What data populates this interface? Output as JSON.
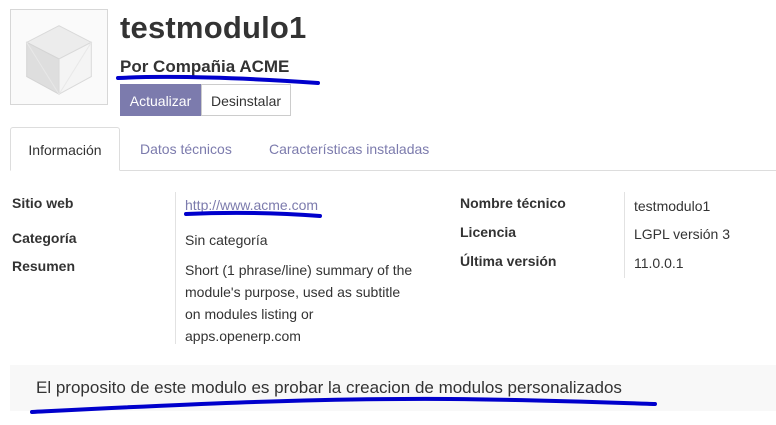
{
  "header": {
    "title": "testmodulo1",
    "author": "Por Compañia ACME",
    "update_button": "Actualizar",
    "uninstall_button": "Desinstalar"
  },
  "tabs": [
    {
      "label": "Información",
      "active": true
    },
    {
      "label": "Datos técnicos",
      "active": false
    },
    {
      "label": "Características instaladas",
      "active": false
    }
  ],
  "info": {
    "left": [
      {
        "label": "Sitio web",
        "value": "http://www.acme.com",
        "is_link": true
      },
      {
        "label": "Categoría",
        "value": "Sin categoría"
      },
      {
        "label": "Resumen",
        "value_lines": [
          "Short (1 phrase/line) summary of the",
          "module's purpose, used as subtitle",
          "on modules listing or",
          "apps.openerp.com"
        ]
      }
    ],
    "right": [
      {
        "label": "Nombre técnico",
        "value": "testmodulo1"
      },
      {
        "label": "Licencia",
        "value": "LGPL versión 3"
      },
      {
        "label": "Última versión",
        "value": "11.0.0.1"
      }
    ]
  },
  "description": "El proposito de este modulo es probar la creacion de modulos personalizados",
  "colors": {
    "accent": "#7c7bad",
    "annotation_ink": "#0000cc"
  },
  "icons": {
    "module": "cube-icon"
  }
}
